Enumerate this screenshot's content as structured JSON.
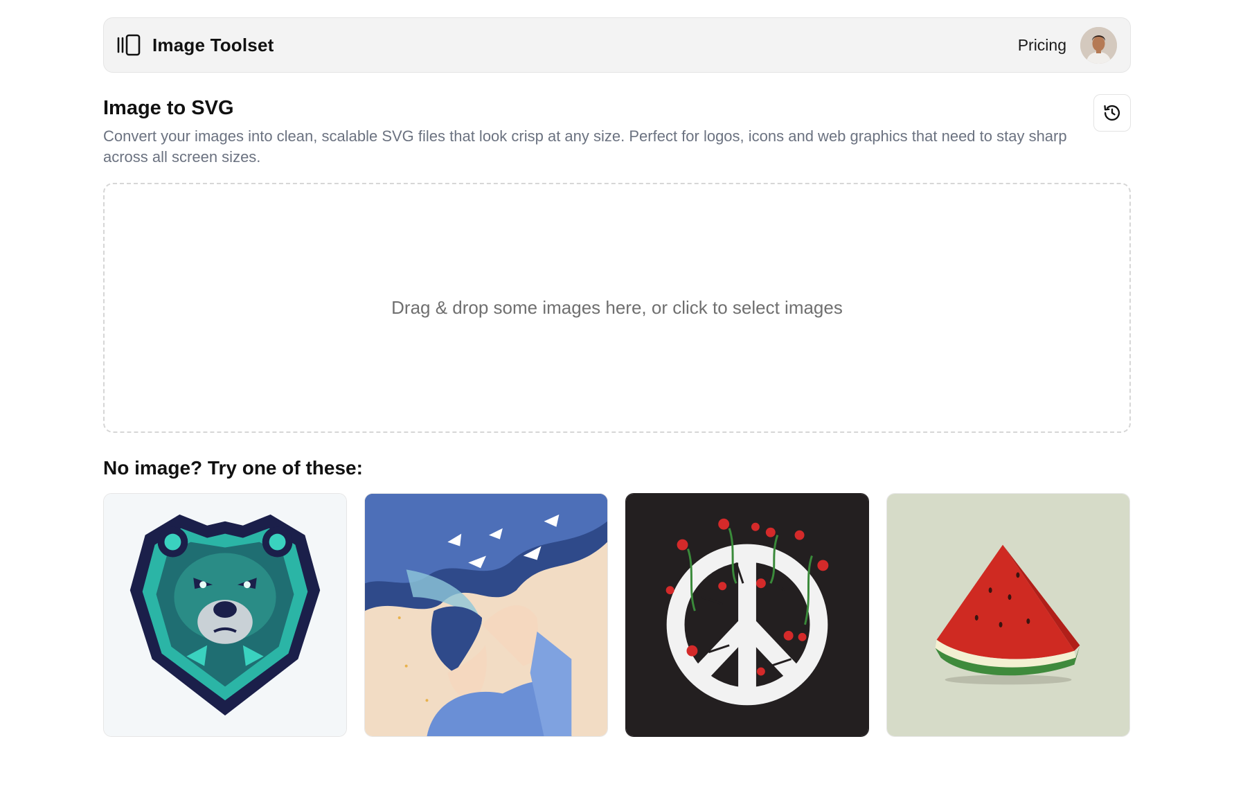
{
  "navbar": {
    "brand_name": "Image Toolset",
    "brand_icon": "sidebar-panel-icon",
    "pricing_label": "Pricing",
    "avatar": "user-avatar"
  },
  "intro": {
    "title": "Image to SVG",
    "description": "Convert your images into clean, scalable SVG files that look crisp at any size. Perfect for logos, icons and web graphics that need to stay sharp across all screen sizes.",
    "history_icon": "history-icon"
  },
  "dropzone": {
    "text": "Drag & drop some images here, or click to select images"
  },
  "samples": {
    "heading": "No image? Try one of these:",
    "items": [
      {
        "subject": "teal bear mascot logo",
        "background": "#f4f7f9"
      },
      {
        "subject": "anime boy with birds flying from hair",
        "background": "#f2dcc4"
      },
      {
        "subject": "cracked peace symbol with red roses",
        "background": "#231f20"
      },
      {
        "subject": "watermelon slice",
        "background": "#d6dbc8"
      }
    ]
  },
  "colors": {
    "navbar_bg": "#f3f3f3",
    "text_primary": "#111111",
    "text_secondary": "#6b7280",
    "dropzone_border": "#d6d6d6"
  }
}
